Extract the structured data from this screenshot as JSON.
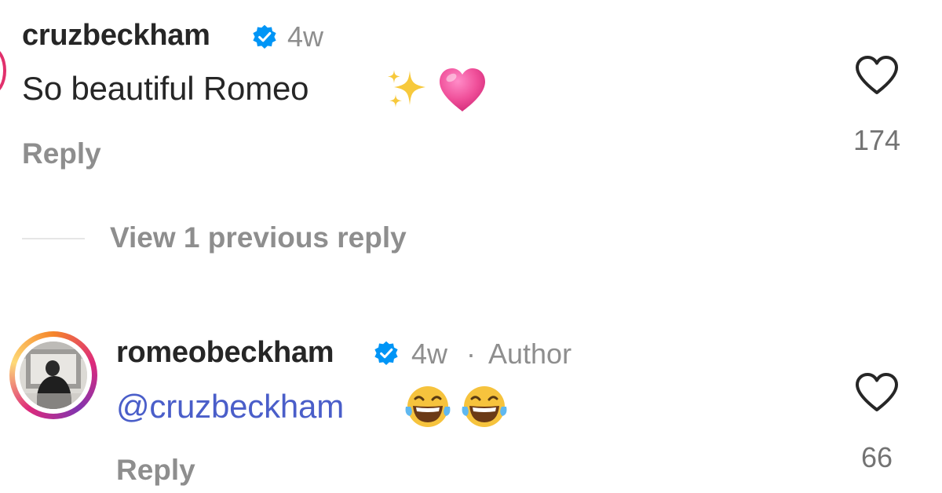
{
  "comments": [
    {
      "username": "cruzbeckham",
      "time": "4w",
      "text": "So beautiful Romeo",
      "emojis": [
        "sparkles-emoji",
        "pink-heart-emoji"
      ],
      "reply_label": "Reply",
      "likes": "174"
    },
    {
      "username": "romeobeckham",
      "time": "4w",
      "separator": "·",
      "author_label": "Author",
      "mention": "@cruzbeckham",
      "emojis": [
        "laughing-tears-emoji",
        "laughing-tears-emoji"
      ],
      "reply_label": "Reply",
      "likes": "66"
    }
  ],
  "thread": {
    "view_replies_label": "View 1 previous reply"
  },
  "colors": {
    "verified": "#0095f6",
    "mention": "#4a5ec9",
    "muted": "#8e8e8e",
    "text": "#262626",
    "heart": "#f0509a"
  },
  "icons": {
    "verified": "verified-badge-icon",
    "like": "heart-outline-icon"
  }
}
